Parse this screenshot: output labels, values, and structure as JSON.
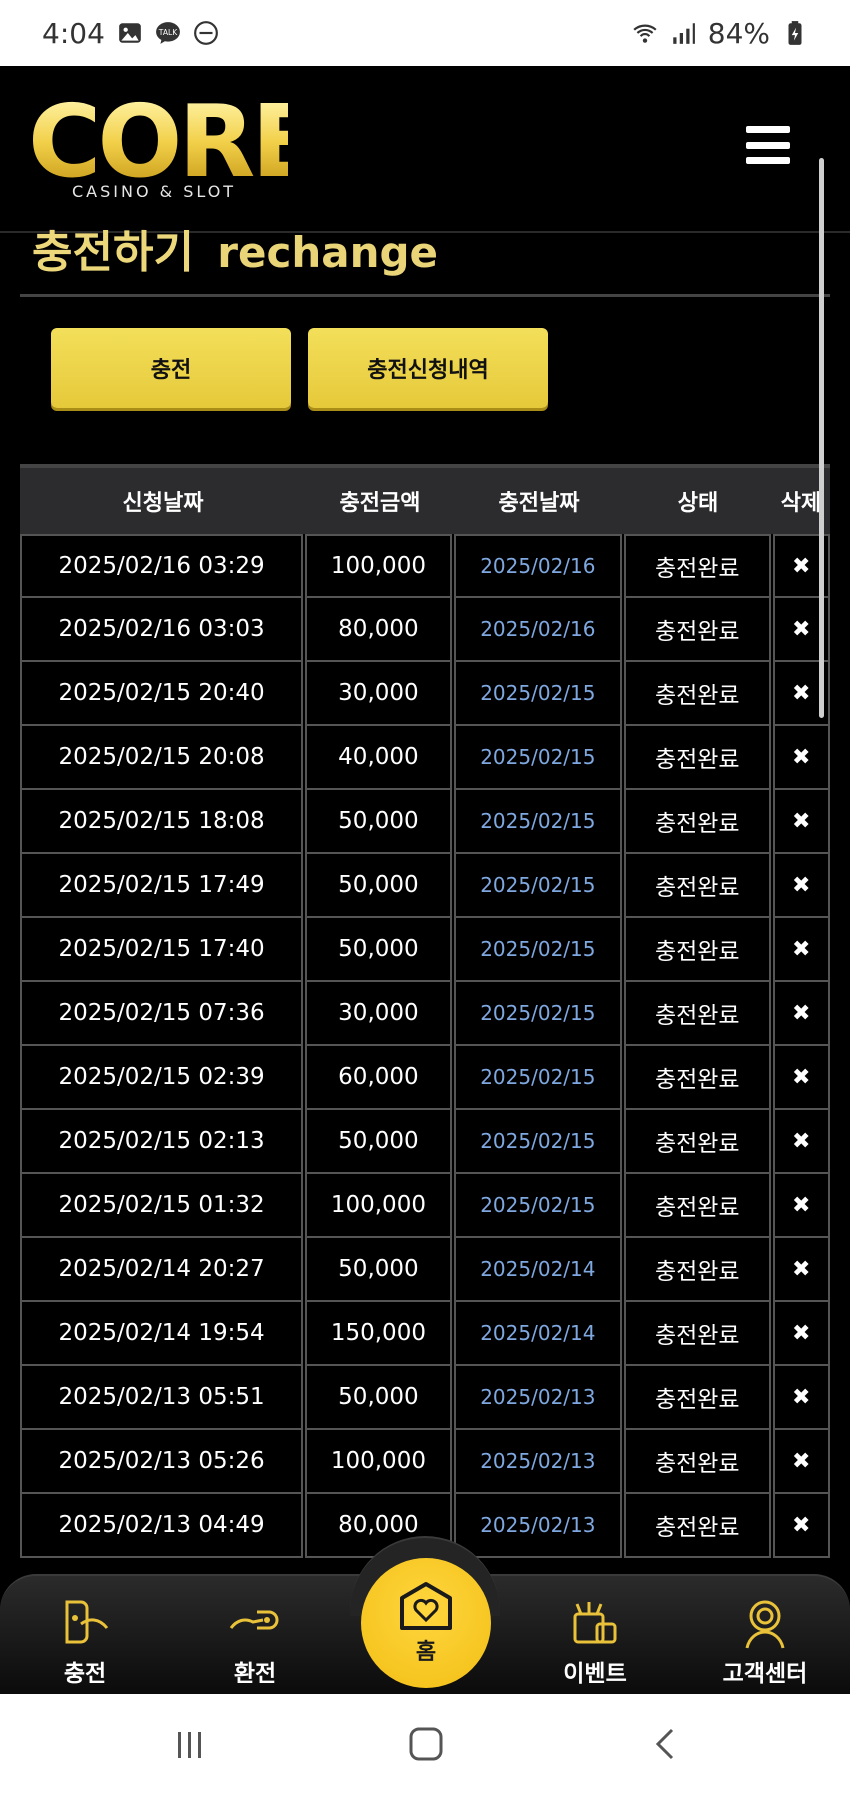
{
  "status_bar": {
    "time": "4:04",
    "battery": "84%"
  },
  "header": {
    "logo_text": "CORE",
    "logo_sub": "CASINO & SLOT"
  },
  "page": {
    "title_ko": "충전하기",
    "title_en": "rechange"
  },
  "actions": {
    "charge_label": "충전",
    "history_label": "충전신청내역"
  },
  "table": {
    "headers": [
      "신청날짜",
      "충전금액",
      "충전날짜",
      "상태",
      "삭제"
    ],
    "rows": [
      [
        "2025/02/16 03:29",
        "100,000",
        "2025/02/16",
        "충전완료"
      ],
      [
        "2025/02/16 03:03",
        "80,000",
        "2025/02/16",
        "충전완료"
      ],
      [
        "2025/02/15 20:40",
        "30,000",
        "2025/02/15",
        "충전완료"
      ],
      [
        "2025/02/15 20:08",
        "40,000",
        "2025/02/15",
        "충전완료"
      ],
      [
        "2025/02/15 18:08",
        "50,000",
        "2025/02/15",
        "충전완료"
      ],
      [
        "2025/02/15 17:49",
        "50,000",
        "2025/02/15",
        "충전완료"
      ],
      [
        "2025/02/15 17:40",
        "50,000",
        "2025/02/15",
        "충전완료"
      ],
      [
        "2025/02/15 07:36",
        "30,000",
        "2025/02/15",
        "충전완료"
      ],
      [
        "2025/02/15 02:39",
        "60,000",
        "2025/02/15",
        "충전완료"
      ],
      [
        "2025/02/15 02:13",
        "50,000",
        "2025/02/15",
        "충전완료"
      ],
      [
        "2025/02/15 01:32",
        "100,000",
        "2025/02/15",
        "충전완료"
      ],
      [
        "2025/02/14 20:27",
        "50,000",
        "2025/02/14",
        "충전완료"
      ],
      [
        "2025/02/14 19:54",
        "150,000",
        "2025/02/14",
        "충전완료"
      ],
      [
        "2025/02/13 05:51",
        "50,000",
        "2025/02/13",
        "충전완료"
      ],
      [
        "2025/02/13 05:26",
        "100,000",
        "2025/02/13",
        "충전완료"
      ],
      [
        "2025/02/13 04:49",
        "80,000",
        "2025/02/13",
        "충전완료"
      ]
    ],
    "delete_glyph": "✖"
  },
  "bottom_nav": {
    "charge": "충전",
    "exchange": "환전",
    "home": "홈",
    "event": "이벤트",
    "support": "고객센터"
  },
  "colors": {
    "accent": "#f2c51c",
    "link_date": "#7fa8e0",
    "title": "#ecd87a"
  }
}
